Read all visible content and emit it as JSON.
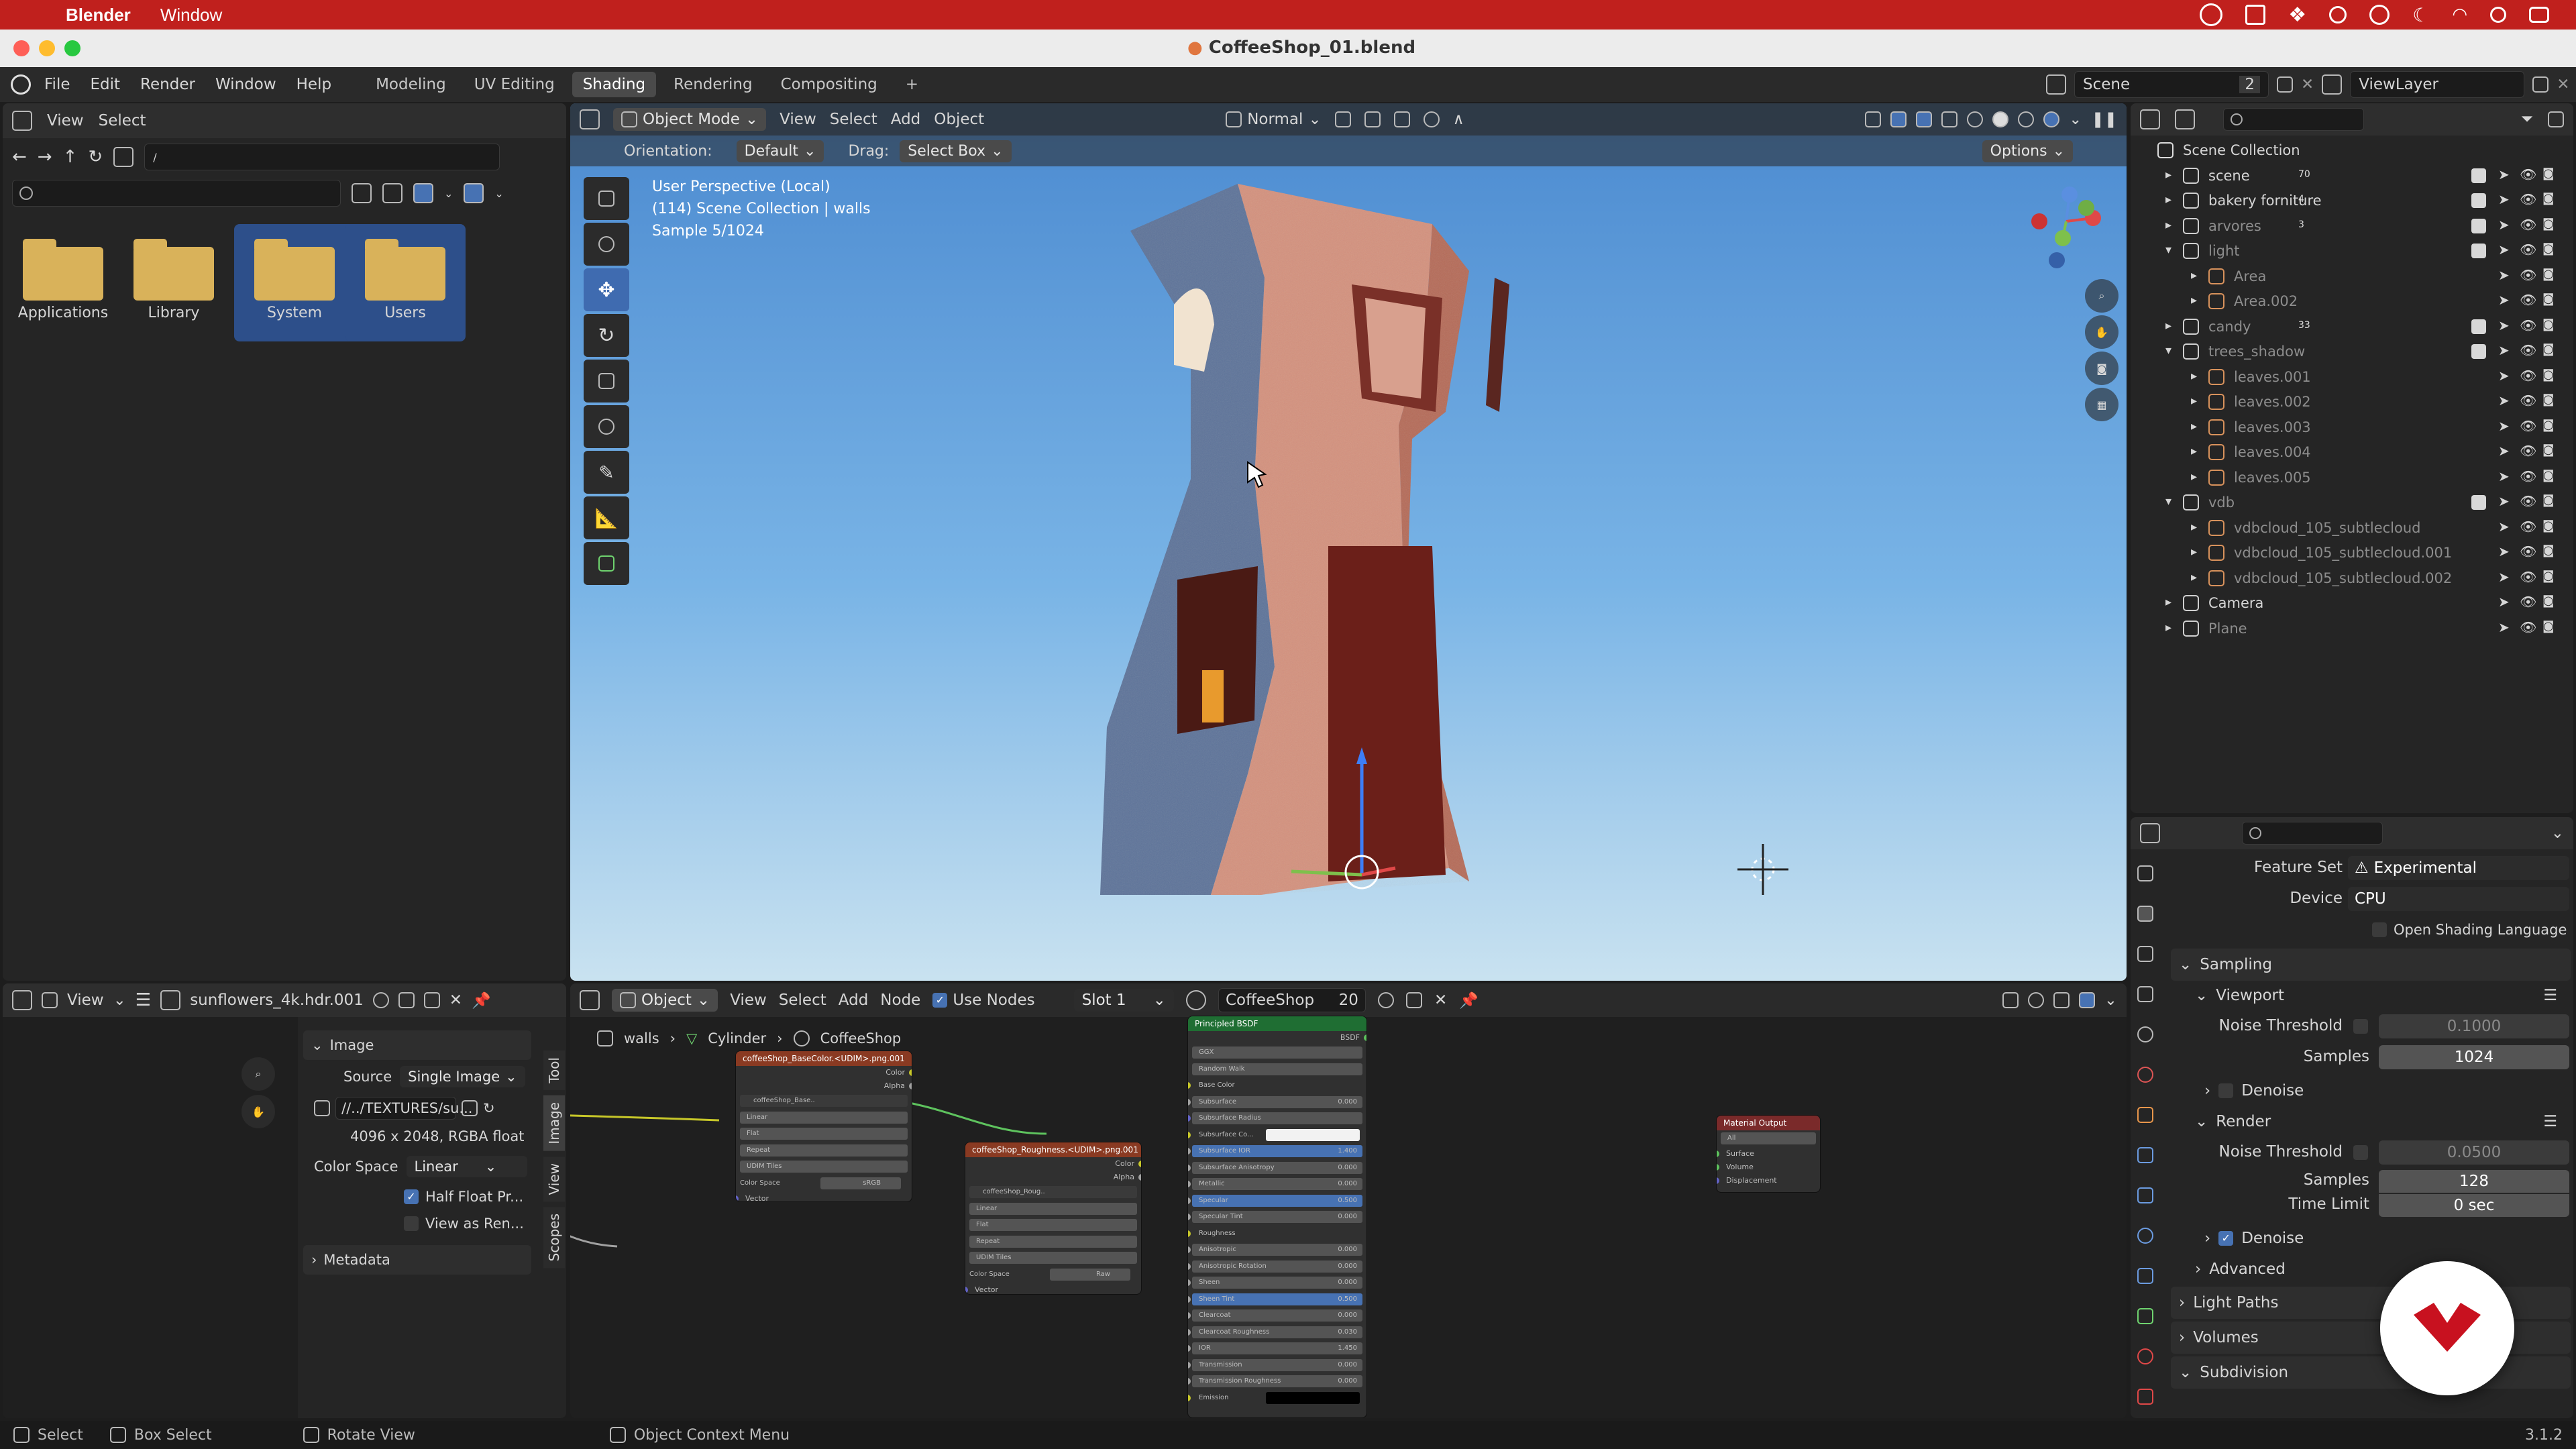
{
  "mac": {
    "app": "Blender",
    "menu_window": "Window"
  },
  "title": "CoffeeShop_01.blend",
  "menu": {
    "items": [
      "File",
      "Edit",
      "Render",
      "Window",
      "Help"
    ],
    "workspaces": [
      "Modeling",
      "UV Editing",
      "Shading",
      "Rendering",
      "Compositing"
    ],
    "active_ws": "Shading",
    "plus": "+",
    "scene_label": "Scene",
    "scene_count": "2",
    "view_layer": "ViewLayer"
  },
  "filebrowser": {
    "view": "View",
    "select": "Select",
    "path": "/",
    "folders": [
      {
        "name": "Applications",
        "selected": false
      },
      {
        "name": "Library",
        "selected": false
      },
      {
        "name": "System",
        "selected": true
      },
      {
        "name": "Users",
        "selected": true
      }
    ]
  },
  "viewport": {
    "mode": "Object Mode",
    "menus": [
      "View",
      "Select",
      "Add",
      "Object"
    ],
    "orientation_label": "Orientation:",
    "orientation": "Default",
    "drag_label": "Drag:",
    "drag": "Select Box",
    "normal": "Normal",
    "options": "Options",
    "info1": "User Perspective (Local)",
    "info2": "(114) Scene Collection | walls",
    "info3": "Sample 5/1024"
  },
  "outliner": {
    "root": "Scene Collection",
    "rows": [
      {
        "name": "scene",
        "level": 0,
        "expand": "▸",
        "badge": "70",
        "dim": false,
        "check": true
      },
      {
        "name": "bakery forniture",
        "level": 0,
        "expand": "▸",
        "badge": "4",
        "dim": false,
        "check": true
      },
      {
        "name": "arvores",
        "level": 0,
        "expand": "▸",
        "badge": "3",
        "dim": true,
        "check": true
      },
      {
        "name": "light",
        "level": 0,
        "expand": "▾",
        "badge": "",
        "dim": true,
        "check": true
      },
      {
        "name": "Area",
        "level": 1,
        "expand": "▸",
        "badge": "",
        "dim": true,
        "check": false
      },
      {
        "name": "Area.002",
        "level": 1,
        "expand": "▸",
        "badge": "",
        "dim": true,
        "check": false
      },
      {
        "name": "candy",
        "level": 0,
        "expand": "▸",
        "badge": "33",
        "dim": true,
        "check": true
      },
      {
        "name": "trees_shadow",
        "level": 0,
        "expand": "▾",
        "badge": "",
        "dim": true,
        "check": true
      },
      {
        "name": "leaves.001",
        "level": 1,
        "expand": "▸",
        "badge": "",
        "dim": true,
        "check": false
      },
      {
        "name": "leaves.002",
        "level": 1,
        "expand": "▸",
        "badge": "",
        "dim": true,
        "check": false
      },
      {
        "name": "leaves.003",
        "level": 1,
        "expand": "▸",
        "badge": "",
        "dim": true,
        "check": false
      },
      {
        "name": "leaves.004",
        "level": 1,
        "expand": "▸",
        "badge": "",
        "dim": true,
        "check": false
      },
      {
        "name": "leaves.005",
        "level": 1,
        "expand": "▸",
        "badge": "",
        "dim": true,
        "check": false
      },
      {
        "name": "vdb",
        "level": 0,
        "expand": "▾",
        "badge": "",
        "dim": true,
        "check": true
      },
      {
        "name": "vdbcloud_105_subtlecloud",
        "level": 1,
        "expand": "▸",
        "badge": "",
        "dim": true,
        "check": false
      },
      {
        "name": "vdbcloud_105_subtlecloud.001",
        "level": 1,
        "expand": "▸",
        "badge": "",
        "dim": true,
        "check": false
      },
      {
        "name": "vdbcloud_105_subtlecloud.002",
        "level": 1,
        "expand": "▸",
        "badge": "",
        "dim": true,
        "check": false
      },
      {
        "name": "Camera",
        "level": 0,
        "expand": "▸",
        "badge": "",
        "dim": false,
        "check": false
      },
      {
        "name": "Plane",
        "level": 0,
        "expand": "▸",
        "badge": "",
        "dim": true,
        "check": false
      }
    ]
  },
  "props": {
    "feature_set_label": "Feature Set",
    "feature_set": "Experimental",
    "device_label": "Device",
    "device": "CPU",
    "osl": "Open Shading Language",
    "sampling": "Sampling",
    "viewport": "Viewport",
    "noise_threshold_label": "Noise Threshold",
    "vp_noise": "0.1000",
    "samples_label": "Samples",
    "vp_samples": "1024",
    "denoise": "Denoise",
    "render": "Render",
    "r_noise": "0.0500",
    "r_samples": "128",
    "time_limit_label": "Time Limit",
    "time_limit": "0 sec",
    "advanced": "Advanced",
    "light_paths": "Light Paths",
    "volumes": "Volumes",
    "subdivision": "Subdivision"
  },
  "image_editor": {
    "view": "View",
    "image_name": "sunflowers_4k.hdr.001",
    "section_image": "Image",
    "source_label": "Source",
    "source": "Single Image",
    "path": "//../TEXTURES/su...",
    "info": "4096 x 2048,  RGBA float",
    "colorspace_label": "Color Space",
    "colorspace": "Linear",
    "half_float": "Half Float Pr...",
    "view_as_render": "View as Ren...",
    "metadata": "Metadata",
    "tabs": [
      "Tool",
      "Image",
      "View",
      "Scopes"
    ]
  },
  "node_editor": {
    "object": "Object",
    "menus": [
      "View",
      "Select",
      "Add",
      "Node"
    ],
    "use_nodes": "Use Nodes",
    "slot": "Slot 1",
    "material": "CoffeeShop",
    "users": "20",
    "bc_walls": "walls",
    "bc_cyl": "Cylinder",
    "bc_mat": "CoffeeShop",
    "tex1": {
      "title": "coffeeShop_BaseColor.<UDIM>.png.001",
      "out1": "Color",
      "out2": "Alpha",
      "img": "coffeeShop_Base..",
      "rows": [
        "Linear",
        "Flat",
        "Repeat",
        "UDIM Tiles"
      ],
      "cs_label": "Color Space",
      "cs": "sRGB",
      "vec": "Vector"
    },
    "tex2": {
      "title": "coffeeShop_Roughness.<UDIM>.png.001",
      "out1": "Color",
      "out2": "Alpha",
      "img": "coffeeShop_Roug..",
      "rows": [
        "Linear",
        "Flat",
        "Repeat",
        "UDIM Tiles"
      ],
      "cs_label": "Color Space",
      "cs": "Raw",
      "vec": "Vector"
    },
    "bsdf": {
      "title": "Principled BSDF",
      "out": "BSDF",
      "dist": "GGX",
      "sss": "Random Walk",
      "rows": [
        {
          "l": "Base Color",
          "v": "",
          "t": "socket"
        },
        {
          "l": "Subsurface",
          "v": "0.000",
          "t": "bar"
        },
        {
          "l": "Subsurface Radius",
          "v": "",
          "t": "dd"
        },
        {
          "l": "Subsurface Co...",
          "v": "",
          "t": "white"
        },
        {
          "l": "Subsurface IOR",
          "v": "1.400",
          "t": "fill"
        },
        {
          "l": "Subsurface Anisotropy",
          "v": "0.000",
          "t": "bar"
        },
        {
          "l": "Metallic",
          "v": "0.000",
          "t": "bar"
        },
        {
          "l": "Specular",
          "v": "0.500",
          "t": "fill"
        },
        {
          "l": "Specular Tint",
          "v": "0.000",
          "t": "bar"
        },
        {
          "l": "Roughness",
          "v": "",
          "t": "socket"
        },
        {
          "l": "Anisotropic",
          "v": "0.000",
          "t": "bar"
        },
        {
          "l": "Anisotropic Rotation",
          "v": "0.000",
          "t": "bar"
        },
        {
          "l": "Sheen",
          "v": "0.000",
          "t": "bar"
        },
        {
          "l": "Sheen Tint",
          "v": "0.500",
          "t": "fill"
        },
        {
          "l": "Clearcoat",
          "v": "0.000",
          "t": "bar"
        },
        {
          "l": "Clearcoat Roughness",
          "v": "0.030",
          "t": "bar"
        },
        {
          "l": "IOR",
          "v": "1.450",
          "t": "bar"
        },
        {
          "l": "Transmission",
          "v": "0.000",
          "t": "bar"
        },
        {
          "l": "Transmission Roughness",
          "v": "0.000",
          "t": "bar"
        },
        {
          "l": "Emission",
          "v": "",
          "t": "black"
        }
      ]
    },
    "output": {
      "title": "Material Output",
      "target": "All",
      "inputs": [
        "Surface",
        "Volume",
        "Displacement"
      ]
    }
  },
  "status": {
    "select": "Select",
    "box_select": "Box Select",
    "rotate": "Rotate View",
    "context": "Object Context Menu",
    "version": "3.1.2"
  },
  "colors": {
    "accent": "#4772b3",
    "selected_folder": "#2d4f8a",
    "mac_bar": "#c0201d",
    "logo": "#c8111f"
  }
}
